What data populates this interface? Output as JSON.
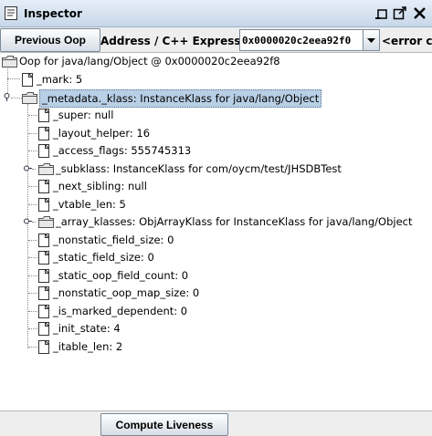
{
  "window": {
    "title": "Inspector",
    "icons": [
      "app-icon",
      "minimize-icon",
      "maximize-icon",
      "close-icon"
    ]
  },
  "toolbar": {
    "previous_oop_label": "Previous Oop",
    "address_label": "Address / C++ Expression:",
    "address_value": "0x0000020c2eea92f0",
    "error_label": "<error com"
  },
  "tree": {
    "root": {
      "label": "Oop for java/lang/Object @ 0x0000020c2eea92f8",
      "icon": "folder-icon"
    },
    "nodes": [
      {
        "label": "_mark: 5",
        "icon": "file-icon"
      },
      {
        "label": "_metadata._klass: InstanceKlass for java/lang/Object",
        "icon": "folder-icon",
        "expanded": true,
        "selected": true
      },
      {
        "label": "_super: null",
        "icon": "file-icon"
      },
      {
        "label": "_layout_helper: 16",
        "icon": "file-icon"
      },
      {
        "label": "_access_flags: 555745313",
        "icon": "file-icon"
      },
      {
        "label": "_subklass: InstanceKlass for com/oycm/test/JHSDBTest",
        "icon": "folder-icon",
        "expanded": false
      },
      {
        "label": "_next_sibling: null",
        "icon": "file-icon"
      },
      {
        "label": "_vtable_len: 5",
        "icon": "file-icon"
      },
      {
        "label": "_array_klasses: ObjArrayKlass for InstanceKlass for java/lang/Object",
        "icon": "folder-icon",
        "expanded": false
      },
      {
        "label": "_nonstatic_field_size: 0",
        "icon": "file-icon"
      },
      {
        "label": "_static_field_size: 0",
        "icon": "file-icon"
      },
      {
        "label": "_static_oop_field_count: 0",
        "icon": "file-icon"
      },
      {
        "label": "_nonstatic_oop_map_size: 0",
        "icon": "file-icon"
      },
      {
        "label": "_is_marked_dependent: 0",
        "icon": "file-icon"
      },
      {
        "label": "_init_state: 4",
        "icon": "file-icon"
      },
      {
        "label": "_itable_len: 2",
        "icon": "file-icon"
      }
    ]
  },
  "footer": {
    "compute_liveness_label": "Compute Liveness"
  }
}
